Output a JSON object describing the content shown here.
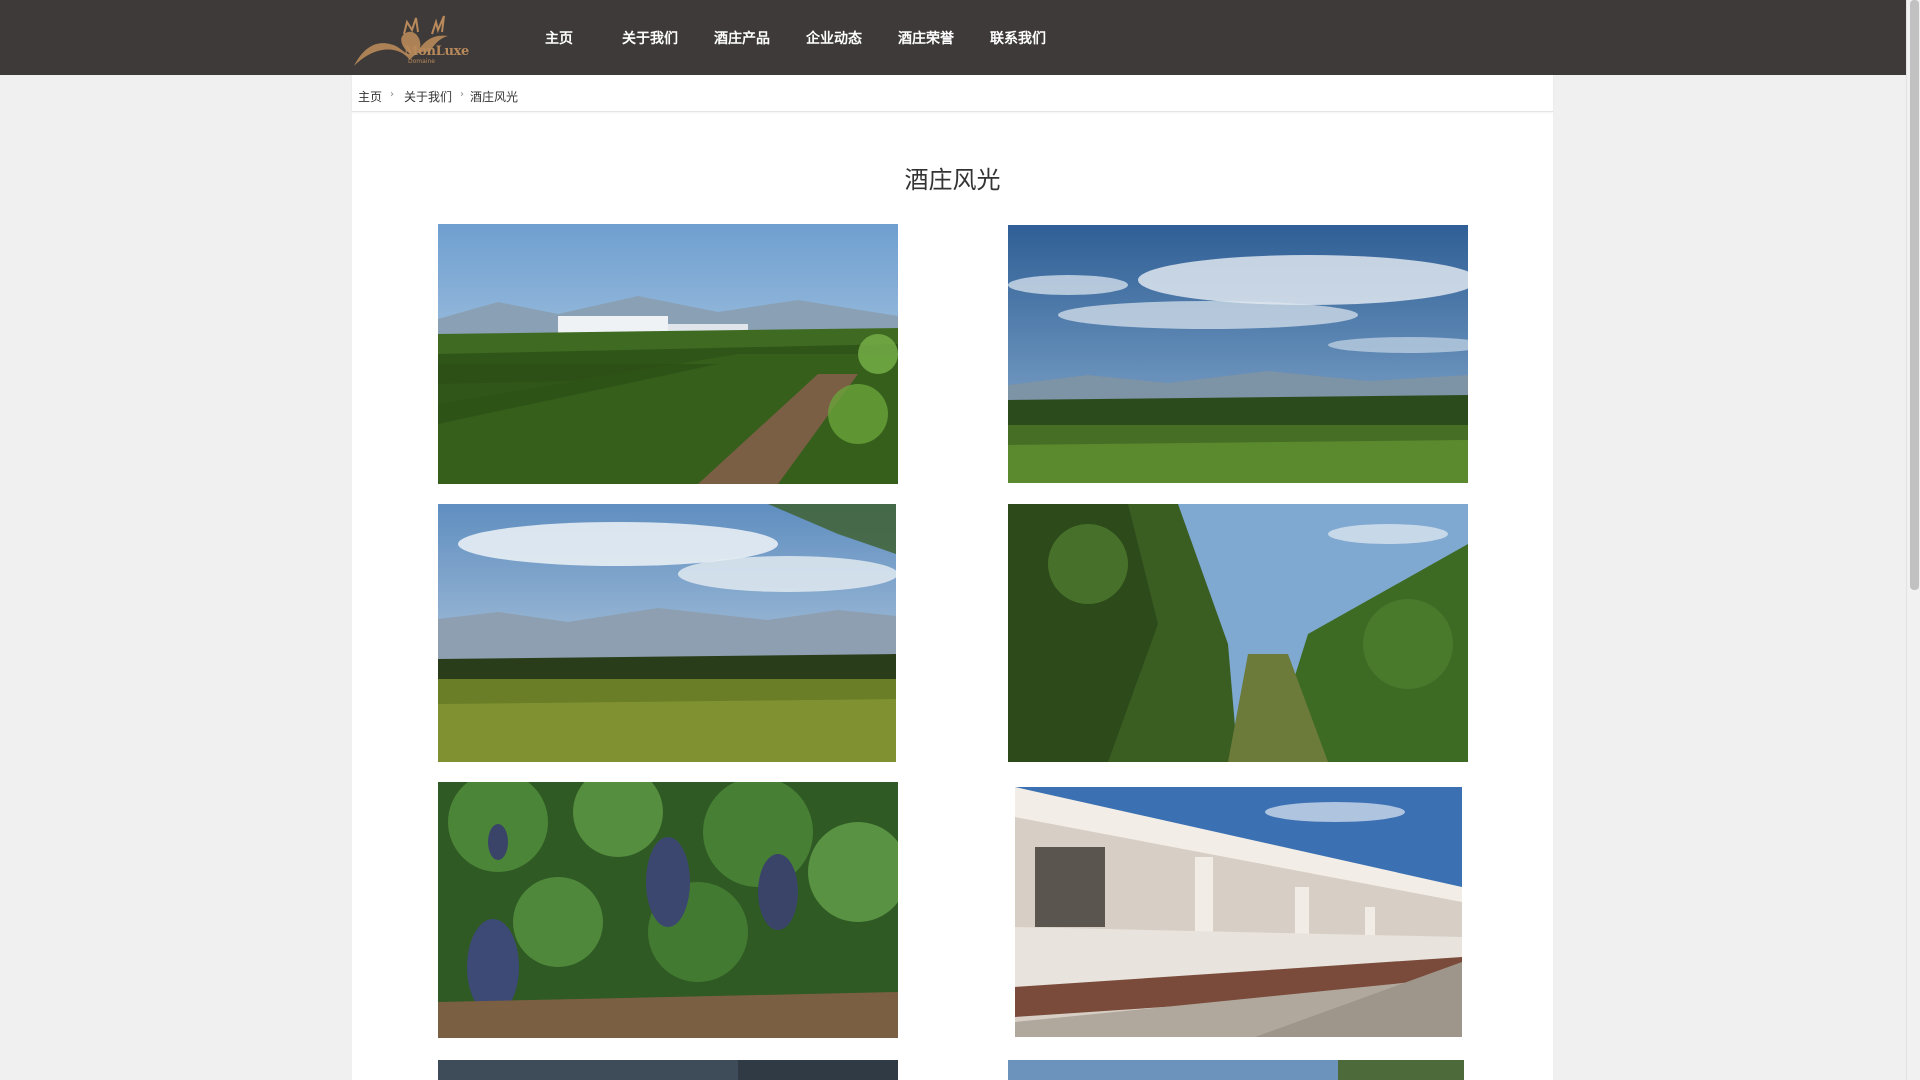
{
  "header": {
    "logo": {
      "brand": "MonLuxe",
      "sub": "Domaine"
    },
    "nav": [
      {
        "label": "主页"
      },
      {
        "label": "关于我们"
      },
      {
        "label": "酒庄产品"
      },
      {
        "label": "企业动态"
      },
      {
        "label": "酒庄荣誉"
      },
      {
        "label": "联系我们"
      }
    ]
  },
  "breadcrumb": {
    "items": [
      "主页",
      "关于我们",
      "酒庄风光"
    ],
    "separator": "›"
  },
  "page": {
    "title": "酒庄风光"
  },
  "gallery": [
    {
      "subject": "vineyard with winery building"
    },
    {
      "subject": "vineyard under cloudy sky"
    },
    {
      "subject": "vineyard with mountains"
    },
    {
      "subject": "vine rows close-up"
    },
    {
      "subject": "grape clusters on vine"
    },
    {
      "subject": "winery porch with columns"
    },
    {
      "subject": "vineyard photo (partially visible)"
    },
    {
      "subject": "vineyard photo (partially visible)"
    }
  ],
  "colors": {
    "header_bg": "#3e3a39",
    "page_bg": "#f0f0f0",
    "content_bg": "#ffffff",
    "logo_gold": "#b8895a",
    "nav_text": "#ffffff"
  }
}
